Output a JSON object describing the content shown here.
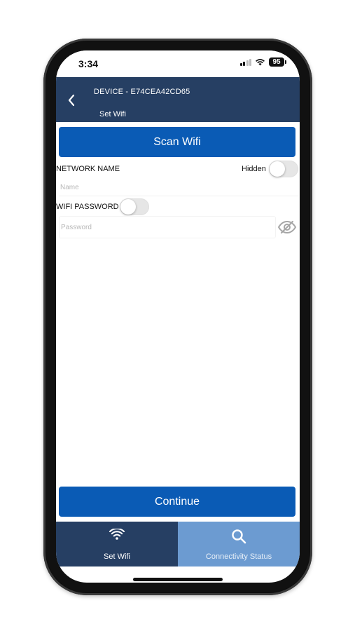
{
  "status_bar": {
    "time": "3:34",
    "battery": "95",
    "icons": [
      "cellular-signal-icon",
      "wifi-icon",
      "battery-icon"
    ]
  },
  "header": {
    "back_icon": "chevron-left-icon",
    "device_title": "DEVICE - E74CEA42CD65",
    "subtitle": "Set Wifi"
  },
  "form": {
    "scan_button_label": "Scan Wifi",
    "network_name_label": "NETWORK NAME",
    "hidden_label": "Hidden",
    "hidden_toggle_on": false,
    "network_name_value": "",
    "network_name_placeholder": "Name",
    "wifi_password_label": "WIFI PASSWORD",
    "password_toggle_on": false,
    "password_value": "",
    "password_placeholder": "Password",
    "password_visibility_icon": "eye-slash-icon"
  },
  "footer": {
    "continue_button_label": "Continue"
  },
  "tab_bar": {
    "tabs": [
      {
        "label": "Set Wifi",
        "icon": "wifi-icon",
        "active": true
      },
      {
        "label": "Connectivity Status",
        "icon": "search-icon",
        "active": false
      }
    ]
  },
  "colors": {
    "header_bg": "#263f63",
    "primary_button": "#0a5bb5",
    "tab_active_bg": "#263f63",
    "tab_inactive_bg": "#6c9bd1"
  }
}
